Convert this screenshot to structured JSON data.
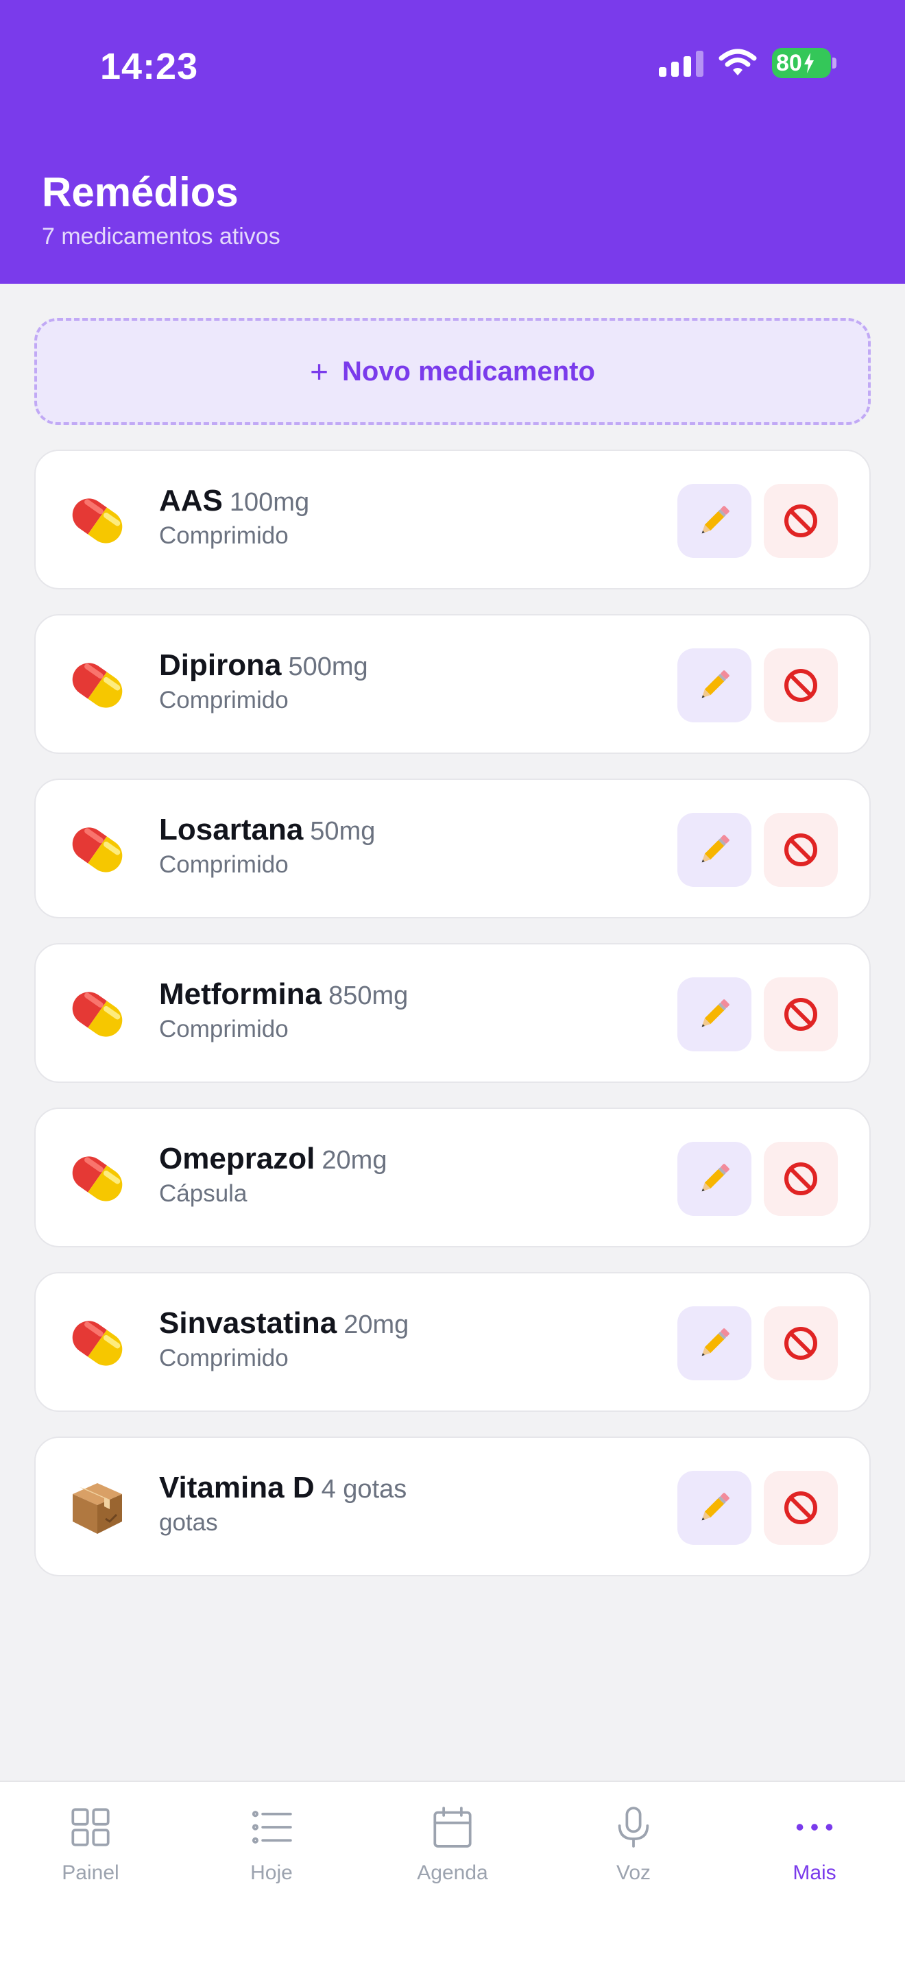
{
  "status_bar": {
    "time": "14:23",
    "battery": "80"
  },
  "header": {
    "title": "Remédios",
    "subtitle": "7 medicamentos ativos"
  },
  "add_button": {
    "icon": "+",
    "label": "Novo medicamento"
  },
  "medications": [
    {
      "name": "AAS",
      "dose": "100mg",
      "form": "Comprimido",
      "icon": "pill-icon"
    },
    {
      "name": "Dipirona",
      "dose": "500mg",
      "form": "Comprimido",
      "icon": "pill-icon"
    },
    {
      "name": "Losartana",
      "dose": "50mg",
      "form": "Comprimido",
      "icon": "pill-icon"
    },
    {
      "name": "Metformina",
      "dose": "850mg",
      "form": "Comprimido",
      "icon": "pill-icon"
    },
    {
      "name": "Omeprazol",
      "dose": "20mg",
      "form": "Cápsula",
      "icon": "pill-icon"
    },
    {
      "name": "Sinvastatina",
      "dose": "20mg",
      "form": "Comprimido",
      "icon": "pill-icon"
    },
    {
      "name": "Vitamina D",
      "dose": "4 gotas",
      "form": "gotas",
      "icon": "package-icon"
    }
  ],
  "tabs": [
    {
      "label": "Painel",
      "icon": "grid-icon",
      "active": false
    },
    {
      "label": "Hoje",
      "icon": "list-icon",
      "active": false
    },
    {
      "label": "Agenda",
      "icon": "calendar-icon",
      "active": false
    },
    {
      "label": "Voz",
      "icon": "microphone-icon",
      "active": false
    },
    {
      "label": "Mais",
      "icon": "more-icon",
      "active": true
    }
  ],
  "colors": {
    "accent": "#7a3beb",
    "background": "#f2f2f4",
    "edit_button_bg": "#ede8fc",
    "deactivate_button_bg": "#fdeeee",
    "battery": "#34c759"
  }
}
